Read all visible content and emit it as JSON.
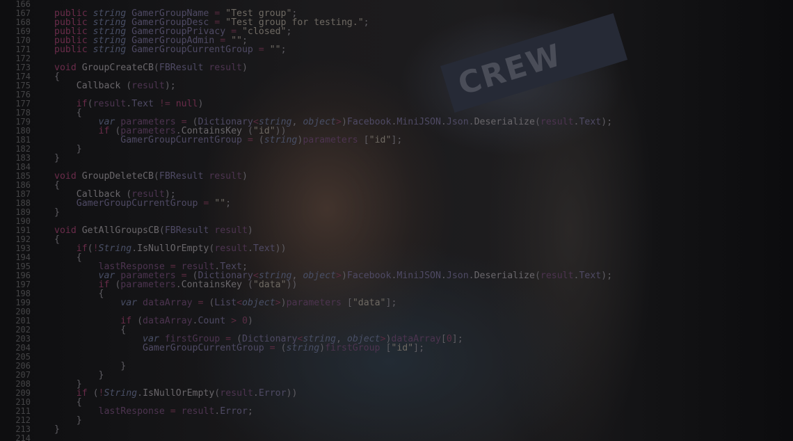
{
  "editor": {
    "line_numbers": [
      "166",
      "167",
      "168",
      "169",
      "170",
      "171",
      "172",
      "173",
      "174",
      "175",
      "176",
      "177",
      "178",
      "179",
      "180",
      "181",
      "182",
      "183",
      "184",
      "185",
      "186",
      "187",
      "188",
      "189",
      "190",
      "191",
      "192",
      "193",
      "194",
      "195",
      "196",
      "197",
      "198",
      "199",
      "200",
      "201",
      "202",
      "203",
      "204",
      "205",
      "206",
      "207",
      "208",
      "209",
      "210",
      "211",
      "212",
      "213",
      "214"
    ],
    "lines": [
      [],
      [
        [
          "kw",
          "public "
        ],
        [
          "type",
          "string "
        ],
        [
          "id",
          "GamerGroupName "
        ],
        [
          "op",
          "= "
        ],
        [
          "str",
          "\"Test group\""
        ],
        [
          "pun",
          ";"
        ]
      ],
      [
        [
          "kw",
          "public "
        ],
        [
          "type",
          "string "
        ],
        [
          "id",
          "GamerGroupDesc "
        ],
        [
          "op",
          "= "
        ],
        [
          "str",
          "\"Test group for testing.\""
        ],
        [
          "pun",
          ";"
        ]
      ],
      [
        [
          "kw",
          "public "
        ],
        [
          "type",
          "string "
        ],
        [
          "id",
          "GamerGroupPrivacy "
        ],
        [
          "op",
          "= "
        ],
        [
          "str",
          "\"closed\""
        ],
        [
          "pun",
          ";"
        ]
      ],
      [
        [
          "kw",
          "public "
        ],
        [
          "type",
          "string "
        ],
        [
          "id",
          "GamerGroupAdmin "
        ],
        [
          "op",
          "= "
        ],
        [
          "str",
          "\"\""
        ],
        [
          "pun",
          ";"
        ]
      ],
      [
        [
          "kw",
          "public "
        ],
        [
          "type",
          "string "
        ],
        [
          "id",
          "GamerGroupCurrentGroup "
        ],
        [
          "op",
          "= "
        ],
        [
          "str",
          "\"\""
        ],
        [
          "pun",
          ";"
        ]
      ],
      [],
      [
        [
          "kw",
          "void "
        ],
        [
          "fn",
          "GroupCreateCB"
        ],
        [
          "pun",
          "("
        ],
        [
          "id",
          "FBResult "
        ],
        [
          "var",
          "result"
        ],
        [
          "pun",
          ")"
        ]
      ],
      [
        [
          "pun",
          "{"
        ]
      ],
      [
        [
          "fn",
          "    Callback "
        ],
        [
          "pun",
          "("
        ],
        [
          "var",
          "result"
        ],
        [
          "pun",
          ");"
        ]
      ],
      [],
      [
        [
          "kw",
          "    if"
        ],
        [
          "pun",
          "("
        ],
        [
          "var",
          "result"
        ],
        [
          "pun",
          "."
        ],
        [
          "id",
          "Text "
        ],
        [
          "op",
          "!= "
        ],
        [
          "kw",
          "null"
        ],
        [
          "pun",
          ")"
        ]
      ],
      [
        [
          "pun",
          "    {"
        ]
      ],
      [
        [
          "type",
          "        var "
        ],
        [
          "var",
          "parameters "
        ],
        [
          "op",
          "= "
        ],
        [
          "pun",
          "("
        ],
        [
          "id",
          "Dictionary"
        ],
        [
          "op",
          "<"
        ],
        [
          "type",
          "string"
        ],
        [
          "pun",
          ", "
        ],
        [
          "type",
          "object"
        ],
        [
          "op",
          ">"
        ],
        [
          "pun",
          ")"
        ],
        [
          "id",
          "Facebook"
        ],
        [
          "pun",
          "."
        ],
        [
          "id",
          "MiniJSON"
        ],
        [
          "pun",
          "."
        ],
        [
          "id",
          "Json"
        ],
        [
          "pun",
          "."
        ],
        [
          "fn",
          "Deserialize"
        ],
        [
          "pun",
          "("
        ],
        [
          "var",
          "result"
        ],
        [
          "pun",
          "."
        ],
        [
          "id",
          "Text"
        ],
        [
          "pun",
          ");"
        ]
      ],
      [
        [
          "kw",
          "        if "
        ],
        [
          "pun",
          "("
        ],
        [
          "var",
          "parameters"
        ],
        [
          "pun",
          "."
        ],
        [
          "fn",
          "ContainsKey "
        ],
        [
          "pun",
          "("
        ],
        [
          "str",
          "\"id\""
        ],
        [
          "pun",
          "))"
        ]
      ],
      [
        [
          "id",
          "            GamerGroupCurrentGroup "
        ],
        [
          "op",
          "= "
        ],
        [
          "pun",
          "("
        ],
        [
          "type",
          "string"
        ],
        [
          "pun",
          ")"
        ],
        [
          "var",
          "parameters "
        ],
        [
          "pun",
          "["
        ],
        [
          "str",
          "\"id\""
        ],
        [
          "pun",
          "];"
        ]
      ],
      [
        [
          "pun",
          "    }"
        ]
      ],
      [
        [
          "pun",
          "}"
        ]
      ],
      [],
      [
        [
          "kw",
          "void "
        ],
        [
          "fn",
          "GroupDeleteCB"
        ],
        [
          "pun",
          "("
        ],
        [
          "id",
          "FBResult "
        ],
        [
          "var",
          "result"
        ],
        [
          "pun",
          ")"
        ]
      ],
      [
        [
          "pun",
          "{"
        ]
      ],
      [
        [
          "fn",
          "    Callback "
        ],
        [
          "pun",
          "("
        ],
        [
          "var",
          "result"
        ],
        [
          "pun",
          ");"
        ]
      ],
      [
        [
          "id",
          "    GamerGroupCurrentGroup "
        ],
        [
          "op",
          "= "
        ],
        [
          "str",
          "\"\""
        ],
        [
          "pun",
          ";"
        ]
      ],
      [
        [
          "pun",
          "}"
        ]
      ],
      [],
      [
        [
          "kw",
          "void "
        ],
        [
          "fn",
          "GetAllGroupsCB"
        ],
        [
          "pun",
          "("
        ],
        [
          "id",
          "FBResult "
        ],
        [
          "var",
          "result"
        ],
        [
          "pun",
          ")"
        ]
      ],
      [
        [
          "pun",
          "{"
        ]
      ],
      [
        [
          "kw",
          "    if"
        ],
        [
          "pun",
          "("
        ],
        [
          "op",
          "!"
        ],
        [
          "type",
          "String"
        ],
        [
          "pun",
          "."
        ],
        [
          "fn",
          "IsNullOrEmpty"
        ],
        [
          "pun",
          "("
        ],
        [
          "var",
          "result"
        ],
        [
          "pun",
          "."
        ],
        [
          "id",
          "Text"
        ],
        [
          "pun",
          "))"
        ]
      ],
      [
        [
          "pun",
          "    {"
        ]
      ],
      [
        [
          "var",
          "        lastResponse "
        ],
        [
          "op",
          "= "
        ],
        [
          "var",
          "result"
        ],
        [
          "pun",
          "."
        ],
        [
          "id",
          "Text"
        ],
        [
          "pun",
          ";"
        ]
      ],
      [
        [
          "type",
          "        var "
        ],
        [
          "var",
          "parameters "
        ],
        [
          "op",
          "= "
        ],
        [
          "pun",
          "("
        ],
        [
          "id",
          "Dictionary"
        ],
        [
          "op",
          "<"
        ],
        [
          "type",
          "string"
        ],
        [
          "pun",
          ", "
        ],
        [
          "type",
          "object"
        ],
        [
          "op",
          ">"
        ],
        [
          "pun",
          ")"
        ],
        [
          "id",
          "Facebook"
        ],
        [
          "pun",
          "."
        ],
        [
          "id",
          "MiniJSON"
        ],
        [
          "pun",
          "."
        ],
        [
          "id",
          "Json"
        ],
        [
          "pun",
          "."
        ],
        [
          "fn",
          "Deserialize"
        ],
        [
          "pun",
          "("
        ],
        [
          "var",
          "result"
        ],
        [
          "pun",
          "."
        ],
        [
          "id",
          "Text"
        ],
        [
          "pun",
          ");"
        ]
      ],
      [
        [
          "kw",
          "        if "
        ],
        [
          "pun",
          "("
        ],
        [
          "var",
          "parameters"
        ],
        [
          "pun",
          "."
        ],
        [
          "fn",
          "ContainsKey "
        ],
        [
          "pun",
          "("
        ],
        [
          "str",
          "\"data\""
        ],
        [
          "pun",
          "))"
        ]
      ],
      [
        [
          "pun",
          "        {"
        ]
      ],
      [
        [
          "type",
          "            var "
        ],
        [
          "var",
          "dataArray "
        ],
        [
          "op",
          "= "
        ],
        [
          "pun",
          "("
        ],
        [
          "id",
          "List"
        ],
        [
          "op",
          "<"
        ],
        [
          "type",
          "object"
        ],
        [
          "op",
          ">"
        ],
        [
          "pun",
          ")"
        ],
        [
          "var",
          "parameters "
        ],
        [
          "pun",
          "["
        ],
        [
          "str",
          "\"data\""
        ],
        [
          "pun",
          "];"
        ]
      ],
      [],
      [
        [
          "kw",
          "            if "
        ],
        [
          "pun",
          "("
        ],
        [
          "var",
          "dataArray"
        ],
        [
          "pun",
          "."
        ],
        [
          "id",
          "Count "
        ],
        [
          "op",
          "> "
        ],
        [
          "num",
          "0"
        ],
        [
          "pun",
          ")"
        ]
      ],
      [
        [
          "pun",
          "            {"
        ]
      ],
      [
        [
          "type",
          "                var "
        ],
        [
          "var",
          "firstGroup "
        ],
        [
          "op",
          "= "
        ],
        [
          "pun",
          "("
        ],
        [
          "id",
          "Dictionary"
        ],
        [
          "op",
          "<"
        ],
        [
          "type",
          "string"
        ],
        [
          "pun",
          ", "
        ],
        [
          "type",
          "object"
        ],
        [
          "op",
          ">"
        ],
        [
          "pun",
          ")"
        ],
        [
          "var",
          "dataArray"
        ],
        [
          "pun",
          "["
        ],
        [
          "num",
          "0"
        ],
        [
          "pun",
          "];"
        ]
      ],
      [
        [
          "id",
          "                GamerGroupCurrentGroup "
        ],
        [
          "op",
          "= "
        ],
        [
          "pun",
          "("
        ],
        [
          "type",
          "string"
        ],
        [
          "pun",
          ")"
        ],
        [
          "var",
          "firstGroup "
        ],
        [
          "pun",
          "["
        ],
        [
          "str",
          "\"id\""
        ],
        [
          "pun",
          "];"
        ]
      ],
      [],
      [
        [
          "pun",
          "            }"
        ]
      ],
      [
        [
          "pun",
          "        }"
        ]
      ],
      [
        [
          "pun",
          "    }"
        ]
      ],
      [
        [
          "kw",
          "    if "
        ],
        [
          "pun",
          "("
        ],
        [
          "op",
          "!"
        ],
        [
          "type",
          "String"
        ],
        [
          "pun",
          "."
        ],
        [
          "fn",
          "IsNullOrEmpty"
        ],
        [
          "pun",
          "("
        ],
        [
          "var",
          "result"
        ],
        [
          "pun",
          "."
        ],
        [
          "id",
          "Error"
        ],
        [
          "pun",
          "))"
        ]
      ],
      [
        [
          "pun",
          "    {"
        ]
      ],
      [
        [
          "var",
          "        lastResponse "
        ],
        [
          "op",
          "= "
        ],
        [
          "var",
          "result"
        ],
        [
          "pun",
          "."
        ],
        [
          "id",
          "Error"
        ],
        [
          "pun",
          ";"
        ]
      ],
      [
        [
          "pun",
          "    }"
        ]
      ],
      [
        [
          "pun",
          "}"
        ]
      ],
      []
    ]
  },
  "photo": {
    "banner_text": "CREW"
  },
  "theme": {
    "background": "#0f0f11",
    "line_number_color": "#454547"
  }
}
